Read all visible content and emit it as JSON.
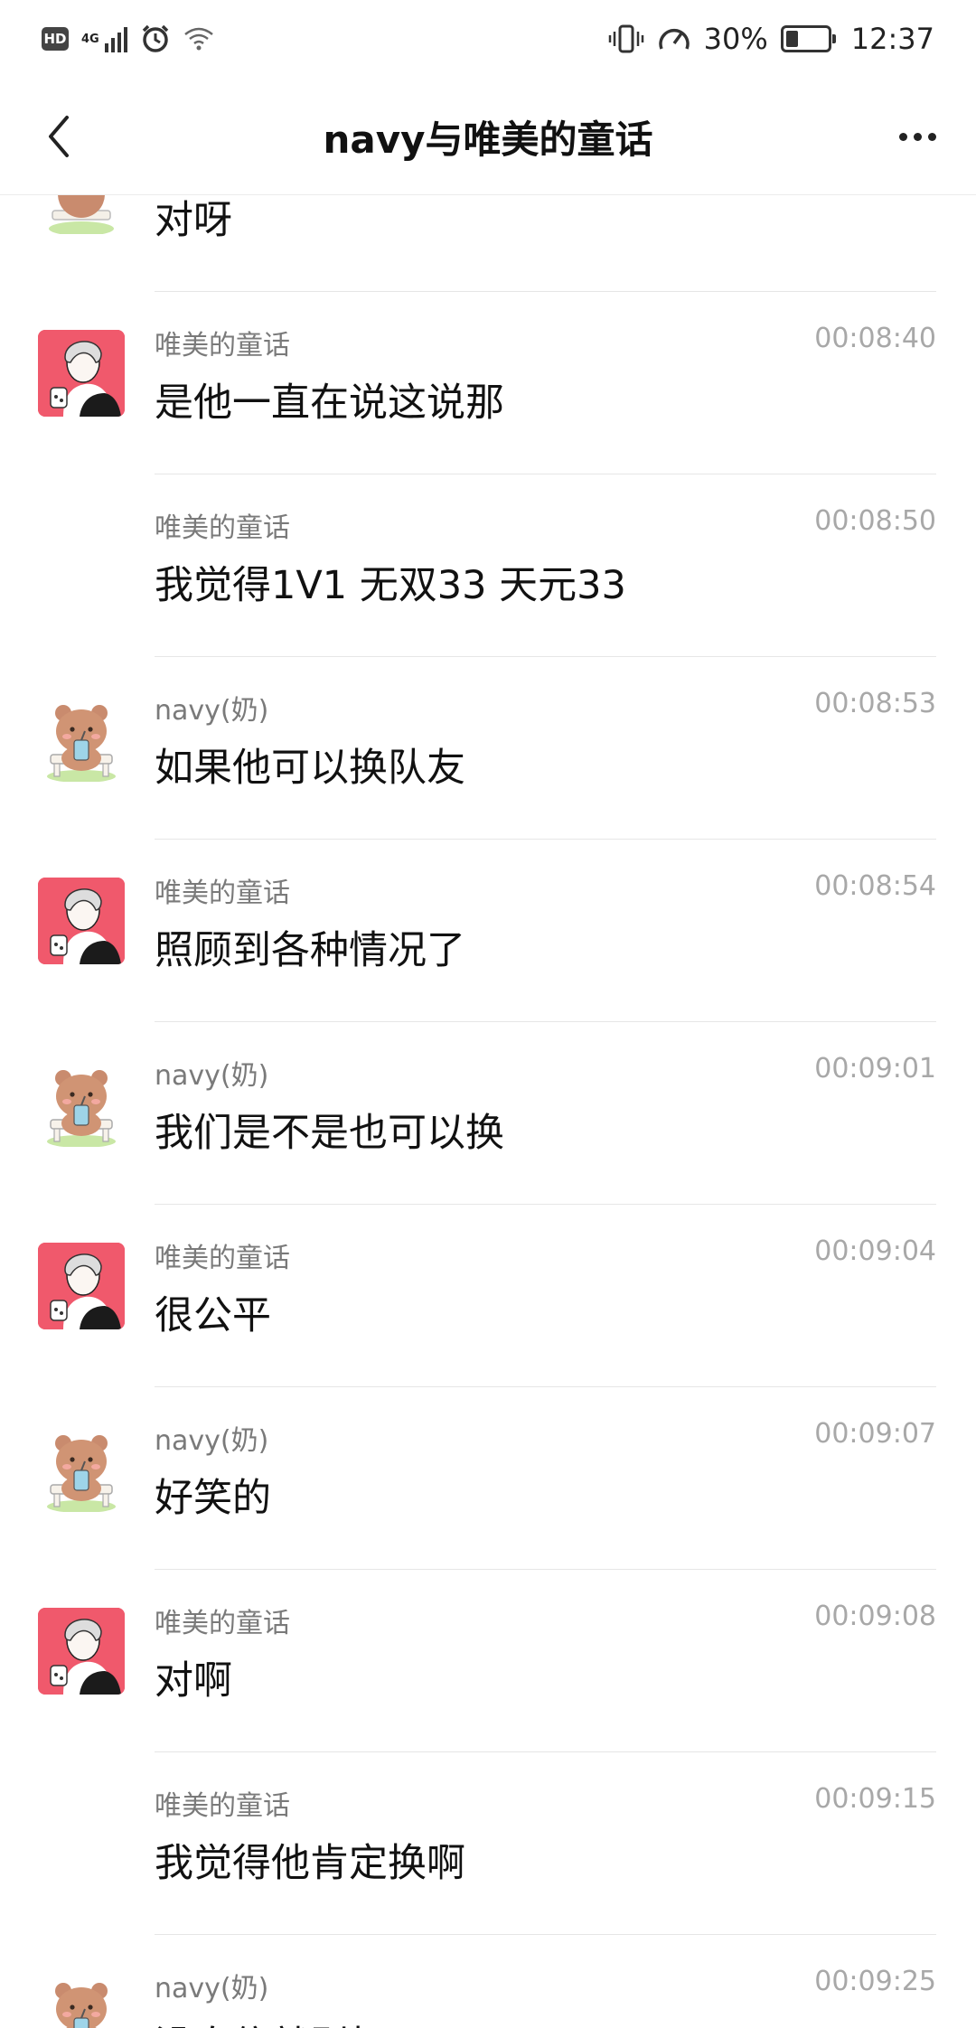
{
  "status_bar": {
    "hd": "HD",
    "network": "4G",
    "battery_text": "30%",
    "battery_level": 0.3,
    "time": "12:37"
  },
  "header": {
    "title": "navy与唯美的童话"
  },
  "partial_top_message": {
    "text": "对呀",
    "avatar": "bear-avatar"
  },
  "messages": [
    {
      "sender": "唯美的童话",
      "time": "00:08:40",
      "text": "是他一直在说这说那",
      "avatar": "girl-avatar"
    },
    {
      "sender": "唯美的童话",
      "time": "00:08:50",
      "text": "我觉得1V1 无双33 天元33",
      "avatar": ""
    },
    {
      "sender": "navy(奶)",
      "time": "00:08:53",
      "text": "如果他可以换队友",
      "avatar": "bear-avatar"
    },
    {
      "sender": "唯美的童话",
      "time": "00:08:54",
      "text": "照顾到各种情况了",
      "avatar": "girl-avatar"
    },
    {
      "sender": "navy(奶)",
      "time": "00:09:01",
      "text": "我们是不是也可以换",
      "avatar": "bear-avatar"
    },
    {
      "sender": "唯美的童话",
      "time": "00:09:04",
      "text": "很公平",
      "avatar": "girl-avatar"
    },
    {
      "sender": "navy(奶)",
      "time": "00:09:07",
      "text": "好笑的",
      "avatar": "bear-avatar"
    },
    {
      "sender": "唯美的童话",
      "time": "00:09:08",
      "text": "对啊",
      "avatar": "girl-avatar"
    },
    {
      "sender": "唯美的童话",
      "time": "00:09:15",
      "text": "我觉得他肯定换啊",
      "avatar": ""
    },
    {
      "sender": "navy(奶)",
      "time": "00:09:25",
      "text": "没自信就别打",
      "avatar": "bear-avatar"
    }
  ]
}
